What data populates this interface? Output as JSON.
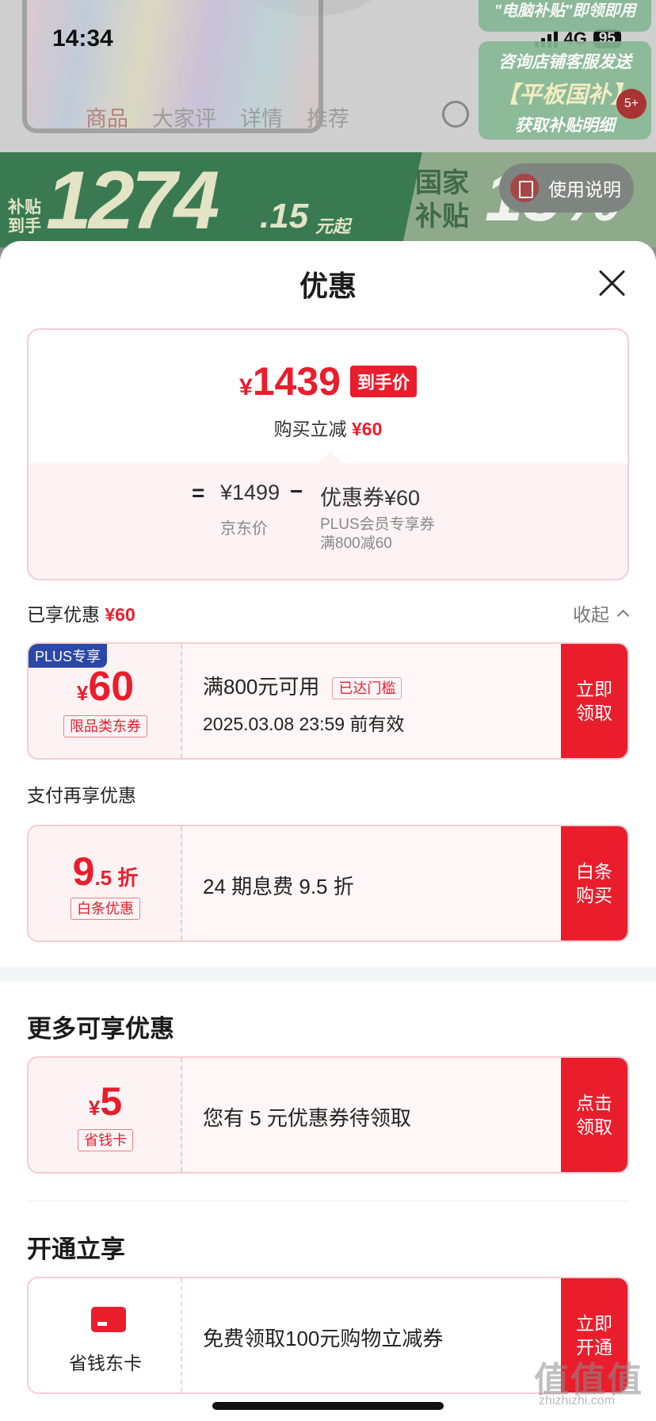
{
  "status_bar": {
    "time": "14:34",
    "network": "4G",
    "battery": "95"
  },
  "background": {
    "tabs": [
      "商品",
      "大家评",
      "详情",
      "推荐"
    ],
    "promo_top": "\"电脑补贴\"即领即用",
    "promo_box": {
      "line1": "咨询店铺客服发送",
      "line2": "【平板国补】",
      "line3": "获取补贴明细"
    },
    "badge": "5+",
    "banner": {
      "label": "补贴\n到手",
      "price": "1274",
      "decimals": ".15",
      "suffix": "元起",
      "gov": "国家\n补贴",
      "pct": "15%"
    },
    "help_button": "使用说明"
  },
  "sheet": {
    "title": "优惠",
    "price_card": {
      "currency": "¥",
      "final_price": "1439",
      "final_tag": "到手价",
      "instant_off_label": "购买立减",
      "instant_off_amount": "¥60",
      "equals": "=",
      "jd_price": "¥1499",
      "jd_label": "京东价",
      "minus": "−",
      "coupon_amount": "优惠券¥60",
      "coupon_desc1": "PLUS会员专享券",
      "coupon_desc2": "满800减60"
    },
    "enjoyed": {
      "label": "已享优惠",
      "amount": "¥60",
      "collapse": "收起"
    },
    "coupon_plus": {
      "corner_tag": "PLUS专享",
      "currency": "¥",
      "value": "60",
      "type_tag": "限品类东券",
      "condition": "满800元可用",
      "status": "已达门槛",
      "expiry": "2025.03.08 23:59 前有效",
      "button": "立即领取"
    },
    "pay_section": {
      "label": "支付再享优惠"
    },
    "coupon_baitiao": {
      "value_big": "9",
      "value_small": ".5 折",
      "type_tag": "白条优惠",
      "desc": "24 期息费 9.5 折",
      "button": "白条购买"
    },
    "more_section": {
      "heading": "更多可享优惠"
    },
    "coupon_card": {
      "currency": "¥",
      "value": "5",
      "type_tag": "省钱卡",
      "desc": "您有 5 元优惠券待领取",
      "button": "点击领取"
    },
    "open_section": {
      "heading": "开通立享"
    },
    "coupon_open": {
      "name": "省钱东卡",
      "desc": "免费领取100元购物立减券",
      "button": "立即开通"
    }
  },
  "watermark": {
    "text": "值值值",
    "url": "zhizhizhi.com"
  },
  "colors": {
    "accent": "#ea1d2c",
    "plus_blue": "#2b47a7",
    "coupon_bg": "#fdf3f4"
  }
}
